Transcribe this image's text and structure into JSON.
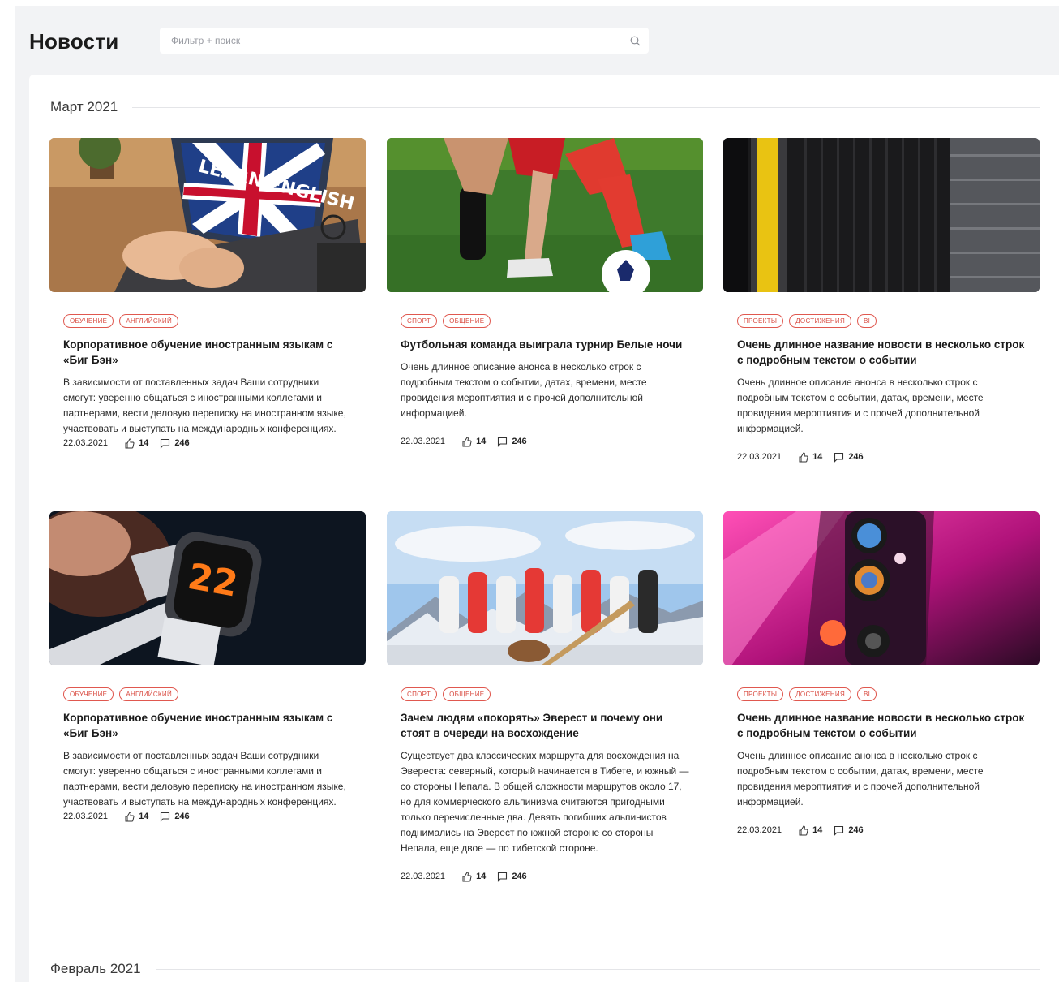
{
  "header": {
    "title": "Новости",
    "search_placeholder": "Фильтр + поиск"
  },
  "months": [
    {
      "label": "Март 2021"
    },
    {
      "label": "Февраль 2021"
    }
  ],
  "cards": [
    {
      "image": "laptop-learn-english",
      "tags": [
        "обучение",
        "английский"
      ],
      "title": "Корпоративное обучение иностранным языкам с «Биг Бэн»",
      "description": "В зависимости от поставленных задач Ваши сотрудники смогут: уверенно общаться с иностранными коллегами и партнерами, вести деловую переписку на иностранном языке, участвовать и выступать на международных конференциях.",
      "date": "22.03.2021",
      "likes": "14",
      "comments": "246"
    },
    {
      "image": "football-players",
      "tags": [
        "спорт",
        "общение"
      ],
      "title": "Футбольная команда выиграла турнир Белые ночи",
      "description": "Очень длинное описание анонса в несколько строк с подробным текстом о событии, датах, времени, месте провидения мероптиятия и с прочей дополнительной информацией.",
      "date": "22.03.2021",
      "likes": "14",
      "comments": "246"
    },
    {
      "image": "dark-stripes",
      "tags": [
        "проекты",
        "достижения",
        "BI"
      ],
      "title": "Очень длинное название новости в несколько строк с подробным текстом о событии",
      "description": "Очень длинное описание анонса в несколько строк с подробным текстом о событии, датах, времени, месте провидения мероптиятия и с прочей дополнительной информацией.",
      "date": "22.03.2021",
      "likes": "14",
      "comments": "246"
    },
    {
      "image": "smartwatch",
      "tags": [
        "обучение",
        "английский"
      ],
      "title": "Корпоративное обучение иностранным языкам с «Биг Бэн»",
      "description": "В зависимости от поставленных задач Ваши сотрудники смогут: уверенно общаться с иностранными коллегами и партнерами, вести деловую переписку на иностранном языке, участвовать и выступать на международных конференциях.",
      "date": "22.03.2021",
      "likes": "14",
      "comments": "246"
    },
    {
      "image": "mountain-group",
      "tags": [
        "спорт",
        "общение"
      ],
      "title": "Зачем людям «покорять» Эверест и почему они стоят в очереди на восхождение",
      "description": "Существует два классических маршрута для восхождения на Эвереста: северный, который начинается в Тибете, и южный — со стороны Непала. В общей сложности маршрутов около 17, но для коммерческого альпинизма считаются пригодными только перечисленные два. Девять погибших альпинистов поднимались на Эверест по южной стороне со стороны Непала, еще двое — по тибетской стороне.",
      "date": "22.03.2021",
      "likes": "14",
      "comments": "246"
    },
    {
      "image": "phone-camera",
      "tags": [
        "проекты",
        "достижения",
        "BI"
      ],
      "title": "Очень длинное название новости в несколько строк с подробным текстом о событии",
      "description": "Очень длинное описание анонса в несколько строк с подробным текстом о событии, датах, времени, месте провидения мероптиятия и с прочей дополнительной информацией.",
      "date": "22.03.2021",
      "likes": "14",
      "comments": "246"
    }
  ],
  "colors": {
    "tag": "#d94b41",
    "background": "#f2f3f5",
    "surface": "#ffffff"
  }
}
